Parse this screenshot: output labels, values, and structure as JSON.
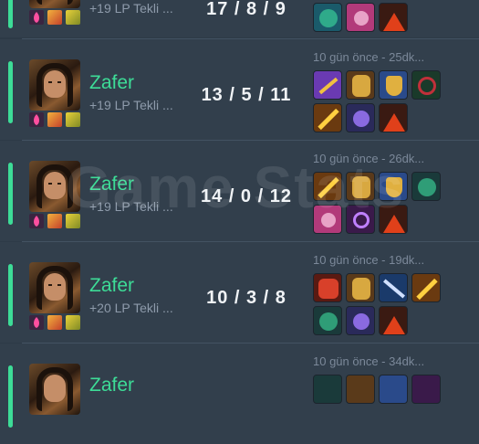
{
  "watermark": "Game Stats",
  "matches": [
    {
      "result": "",
      "lp": "+19 LP Tekli ...",
      "kda": "17 / 8 / 9",
      "time": "",
      "items": [
        {
          "icon": "winged-blade-item-icon",
          "color": "#1a5a6a"
        },
        {
          "icon": "crystal-orb-item-icon",
          "color": "#b23a7a"
        },
        {
          "icon": "volcano-item-icon",
          "color": "#c53a1a"
        }
      ]
    },
    {
      "result": "Zafer",
      "lp": "+19 LP Tekli ...",
      "kda": "13 / 5 / 11",
      "time": "10 gün önce - 25dk...",
      "items": [
        {
          "icon": "spellblade-item-icon",
          "color": "#6a3ab2"
        },
        {
          "icon": "golden-armor-item-icon",
          "color": "#c89a3a"
        },
        {
          "icon": "golden-shield-item-icon",
          "color": "#2a6ab2"
        },
        {
          "icon": "green-blade-item-icon",
          "color": "#1a8a6a"
        },
        {
          "icon": "flame-sword-item-icon",
          "color": "#e8a02a"
        },
        {
          "icon": "arcane-orb-item-icon",
          "color": "#4a3a9a"
        },
        {
          "icon": "volcano-item-icon",
          "color": "#c53a1a"
        }
      ]
    },
    {
      "result": "Zafer",
      "lp": "+19 LP Tekli ...",
      "kda": "14 / 0 / 12",
      "time": "10 gün önce - 26dk...",
      "items": [
        {
          "icon": "flame-sword-item-icon",
          "color": "#e8a02a"
        },
        {
          "icon": "golden-armor-item-icon",
          "color": "#c89a3a"
        },
        {
          "icon": "golden-shield-item-icon",
          "color": "#2a6ab2"
        },
        {
          "icon": "winged-blade-item-icon",
          "color": "#1a5a6a"
        },
        {
          "icon": "crystal-orb-item-icon",
          "color": "#b23a7a"
        },
        {
          "icon": "void-orb-item-icon",
          "color": "#7a3ab2"
        },
        {
          "icon": "volcano-item-icon",
          "color": "#c53a1a"
        }
      ]
    },
    {
      "result": "Zafer",
      "lp": "+20 LP Tekli ...",
      "kda": "10 / 3 / 8",
      "time": "10 gün önce - 19dk...",
      "items": [
        {
          "icon": "crimson-armor-item-icon",
          "color": "#c5301a"
        },
        {
          "icon": "golden-armor-item-icon",
          "color": "#c89a3a"
        },
        {
          "icon": "spear-item-icon",
          "color": "#2a6ab2"
        },
        {
          "icon": "flame-sword-item-icon",
          "color": "#e8a02a"
        },
        {
          "icon": "winged-blade-item-icon",
          "color": "#1a5a6a"
        },
        {
          "icon": "arcane-orb-item-icon",
          "color": "#4a3a9a"
        },
        {
          "icon": "volcano-item-icon",
          "color": "#c53a1a"
        }
      ]
    },
    {
      "result": "Zafer",
      "lp": "",
      "kda": "",
      "time": "10 gün önce - 34dk...",
      "items": [
        {
          "icon": "winged-blade-item-icon",
          "color": "#1a5a6a"
        },
        {
          "icon": "golden-armor-item-icon",
          "color": "#c89a3a"
        },
        {
          "icon": "void-orb-item-icon",
          "color": "#7a3ab2"
        }
      ]
    }
  ]
}
